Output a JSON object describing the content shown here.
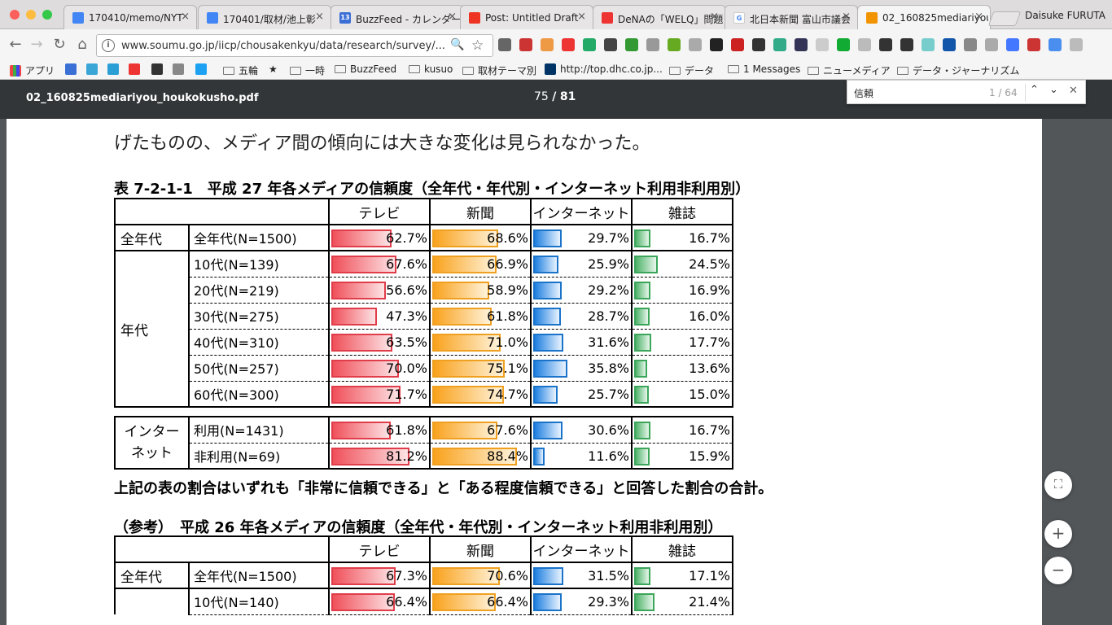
{
  "browser": {
    "tabs": [
      {
        "title": "170410/memo/NYT",
        "icon": "docs-icon",
        "color": "#4285f4"
      },
      {
        "title": "170401/取材/池上彰",
        "icon": "docs-icon",
        "color": "#4285f4"
      },
      {
        "title": "BuzzFeed - カレンダー",
        "icon": "calendar-icon",
        "color": "#3b6fd6"
      },
      {
        "title": "Post: Untitled Draft",
        "icon": "bf-icon",
        "color": "#e32"
      },
      {
        "title": "DeNAの「WELQ」問題",
        "icon": "trend-icon",
        "color": "#e33"
      },
      {
        "title": "北日本新聞 富山市議会",
        "icon": "google-icon",
        "color": "#fff"
      },
      {
        "title": "02_160825mediariyou",
        "icon": "pdf-icon",
        "color": "#f29400"
      }
    ],
    "calendar_badge": "13",
    "profile": "Daisuke FURUTA",
    "url": "www.soumu.go.jp/iicp/chousakenkyu/data/research/survey/...",
    "bookmarks": [
      "アプリ",
      "五輪",
      "一時",
      "BuzzFeed",
      "kusuo",
      "取材テーマ別",
      "http://top.dhc.co.jp...",
      "データ",
      "1 Messages",
      "ニューメディア",
      "データ・ジャーナリズム"
    ]
  },
  "pdf": {
    "filename": "02_160825mediariyou_houkokusho.pdf",
    "page_current": "75",
    "page_sep": "/",
    "page_total": "81"
  },
  "find": {
    "query": "信頼",
    "count": "1 / 64"
  },
  "doc": {
    "intro": "げたものの、メディア間の傾向には大きな変化は見られなかった。",
    "table1_caption": "表 7-2-1-1　平成 27 年各メディアの信頼度（全年代・年代別・インターネット利用非利用別）",
    "note": "上記の表の割合はいずれも「非常に信頼できる」と「ある程度信頼できる」と回答した割合の合計。",
    "table2_caption": "（参考）　平成 26 年各メディアの信頼度（全年代・年代別・インターネット利用非利用別）",
    "headers": [
      "テレビ",
      "新聞",
      "インターネット",
      "雑誌"
    ],
    "t1": {
      "all": {
        "group": "全年代",
        "label": "全年代(N=1500)",
        "values": [
          "62.7%",
          "68.6%",
          "29.7%",
          "16.7%"
        ],
        "nums": [
          62.7,
          68.6,
          29.7,
          16.7
        ]
      },
      "age_group": "年代",
      "ages": [
        {
          "label": "10代(N=139)",
          "values": [
            "67.6%",
            "66.9%",
            "25.9%",
            "24.5%"
          ],
          "nums": [
            67.6,
            66.9,
            25.9,
            24.5
          ]
        },
        {
          "label": "20代(N=219)",
          "values": [
            "56.6%",
            "58.9%",
            "29.2%",
            "16.9%"
          ],
          "nums": [
            56.6,
            58.9,
            29.2,
            16.9
          ]
        },
        {
          "label": "30代(N=275)",
          "values": [
            "47.3%",
            "61.8%",
            "28.7%",
            "16.0%"
          ],
          "nums": [
            47.3,
            61.8,
            28.7,
            16.0
          ]
        },
        {
          "label": "40代(N=310)",
          "values": [
            "63.5%",
            "71.0%",
            "31.6%",
            "17.7%"
          ],
          "nums": [
            63.5,
            71.0,
            31.6,
            17.7
          ]
        },
        {
          "label": "50代(N=257)",
          "values": [
            "70.0%",
            "75.1%",
            "35.8%",
            "13.6%"
          ],
          "nums": [
            70.0,
            75.1,
            35.8,
            13.6
          ]
        },
        {
          "label": "60代(N=300)",
          "values": [
            "71.7%",
            "74.7%",
            "25.7%",
            "15.0%"
          ],
          "nums": [
            71.7,
            74.7,
            25.7,
            15.0
          ]
        }
      ],
      "net_group_l1": "インター",
      "net_group_l2": "ネット",
      "net": [
        {
          "label": "利用(N=1431)",
          "values": [
            "61.8%",
            "67.6%",
            "30.6%",
            "16.7%"
          ],
          "nums": [
            61.8,
            67.6,
            30.6,
            16.7
          ]
        },
        {
          "label": "非利用(N=69)",
          "values": [
            "81.2%",
            "88.4%",
            "11.6%",
            "15.9%"
          ],
          "nums": [
            81.2,
            88.4,
            11.6,
            15.9
          ]
        }
      ]
    },
    "t2": {
      "all": {
        "group": "全年代",
        "label": "全年代(N=1500)",
        "values": [
          "67.3%",
          "70.6%",
          "31.5%",
          "17.1%"
        ],
        "nums": [
          67.3,
          70.6,
          31.5,
          17.1
        ]
      },
      "ages": [
        {
          "label": "10代(N=140)",
          "values": [
            "66.4%",
            "66.4%",
            "29.3%",
            "21.4%"
          ],
          "nums": [
            66.4,
            66.4,
            29.3,
            21.4
          ]
        }
      ]
    }
  },
  "zoom": {
    "fit": "⛶",
    "plus": "+",
    "minus": "−"
  }
}
